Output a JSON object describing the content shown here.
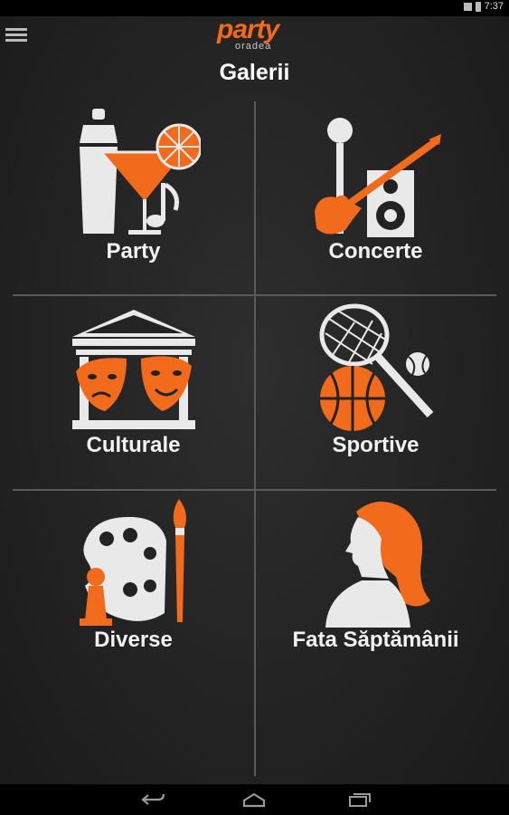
{
  "status": {
    "time": "7:37"
  },
  "header": {
    "logo_main": "party",
    "logo_sub": "oradea",
    "title": "Galerii"
  },
  "gallery": {
    "tiles": [
      {
        "label": "Party",
        "icon": "cocktail-icon"
      },
      {
        "label": "Concerte",
        "icon": "concert-icon"
      },
      {
        "label": "Culturale",
        "icon": "theatre-icon"
      },
      {
        "label": "Sportive",
        "icon": "sports-icon"
      },
      {
        "label": "Diverse",
        "icon": "palette-icon"
      },
      {
        "label": "Fata Săptămânii",
        "icon": "woman-icon"
      }
    ]
  },
  "colors": {
    "accent": "#f26a1b",
    "icon_light": "#e9e9e9",
    "background": "#232323"
  },
  "navbar": {
    "buttons": [
      "back-icon",
      "home-icon",
      "recents-icon"
    ]
  }
}
